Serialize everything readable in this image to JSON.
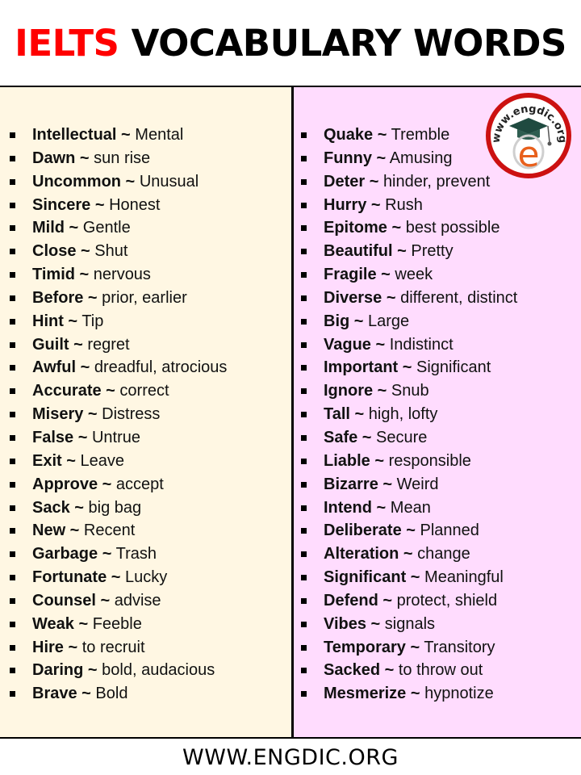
{
  "header": {
    "title_accent": "IELTS",
    "title_rest": "VOCABULARY WORDS",
    "accent_color": "#ff0000"
  },
  "left_column": {
    "background": "#fff7e3",
    "items": [
      {
        "word": "Intellectual ~",
        "meaning": "Mental"
      },
      {
        "word": "Dawn ~",
        "meaning": "sun rise"
      },
      {
        "word": "Uncommon ~",
        "meaning": "Unusual"
      },
      {
        "word": "Sincere ~",
        "meaning": "Honest"
      },
      {
        "word": "Mild ~",
        "meaning": "Gentle"
      },
      {
        "word": "Close ~",
        "meaning": "Shut"
      },
      {
        "word": "Timid ~",
        "meaning": "nervous"
      },
      {
        "word": "Before ~",
        "meaning": "prior, earlier"
      },
      {
        "word": "Hint ~",
        "meaning": "Tip"
      },
      {
        "word": "Guilt ~",
        "meaning": "regret"
      },
      {
        "word": "Awful ~",
        "meaning": "dreadful, atrocious"
      },
      {
        "word": "Accurate ~",
        "meaning": "correct"
      },
      {
        "word": "Misery ~",
        "meaning": "Distress"
      },
      {
        "word": "False ~",
        "meaning": "Untrue"
      },
      {
        "word": "Exit ~",
        "meaning": "Leave"
      },
      {
        "word": "Approve ~",
        "meaning": "accept"
      },
      {
        "word": "Sack ~",
        "meaning": "big bag"
      },
      {
        "word": "New ~",
        "meaning": "Recent"
      },
      {
        "word": "Garbage ~",
        "meaning": "Trash"
      },
      {
        "word": "Fortunate ~",
        "meaning": "Lucky"
      },
      {
        "word": "Counsel ~",
        "meaning": "advise"
      },
      {
        "word": "Weak ~",
        "meaning": "Feeble"
      },
      {
        "word": "Hire ~",
        "meaning": "to recruit"
      },
      {
        "word": "Daring ~",
        "meaning": "bold, audacious"
      },
      {
        "word": "Brave ~",
        "meaning": "Bold"
      }
    ]
  },
  "right_column": {
    "background": "#ffdcfe",
    "items": [
      {
        "word": "Quake ~",
        "meaning": "Tremble"
      },
      {
        "word": "Funny ~",
        "meaning": "Amusing"
      },
      {
        "word": "Deter ~",
        "meaning": "hinder, prevent"
      },
      {
        "word": "Hurry ~",
        "meaning": "Rush"
      },
      {
        "word": "Epitome ~",
        "meaning": "best possible"
      },
      {
        "word": "Beautiful ~",
        "meaning": "Pretty"
      },
      {
        "word": "Fragile ~",
        "meaning": "week"
      },
      {
        "word": "Diverse ~",
        "meaning": "different, distinct"
      },
      {
        "word": "Big ~",
        "meaning": "Large"
      },
      {
        "word": "Vague ~",
        "meaning": "Indistinct"
      },
      {
        "word": "Important ~",
        "meaning": "Significant"
      },
      {
        "word": "Ignore ~",
        "meaning": "Snub"
      },
      {
        "word": "Tall ~",
        "meaning": "high, lofty"
      },
      {
        "word": "Safe ~",
        "meaning": "Secure"
      },
      {
        "word": "Liable ~",
        "meaning": "responsible"
      },
      {
        "word": "Bizarre ~",
        "meaning": "Weird"
      },
      {
        "word": "Intend ~",
        "meaning": "Mean"
      },
      {
        "word": "Deliberate ~",
        "meaning": "Planned"
      },
      {
        "word": "Alteration ~",
        "meaning": "change"
      },
      {
        "word": "Significant ~",
        "meaning": "Meaningful"
      },
      {
        "word": "Defend ~",
        "meaning": "protect, shield"
      },
      {
        "word": "Vibes ~",
        "meaning": "signals"
      },
      {
        "word": "Temporary ~",
        "meaning": "Transitory"
      },
      {
        "word": "Sacked ~",
        "meaning": "to throw out"
      },
      {
        "word": "Mesmerize ~",
        "meaning": "hypnotize"
      }
    ]
  },
  "logo": {
    "icon": "graduation-cap-e-logo",
    "ring_text": "www.engdic.org",
    "ring_color": "#cc1111",
    "letter": "e",
    "letter_color": "#e8601c",
    "cap_color": "#1f4a40"
  },
  "footer": {
    "text": "WWW.ENGDIC.ORG"
  }
}
